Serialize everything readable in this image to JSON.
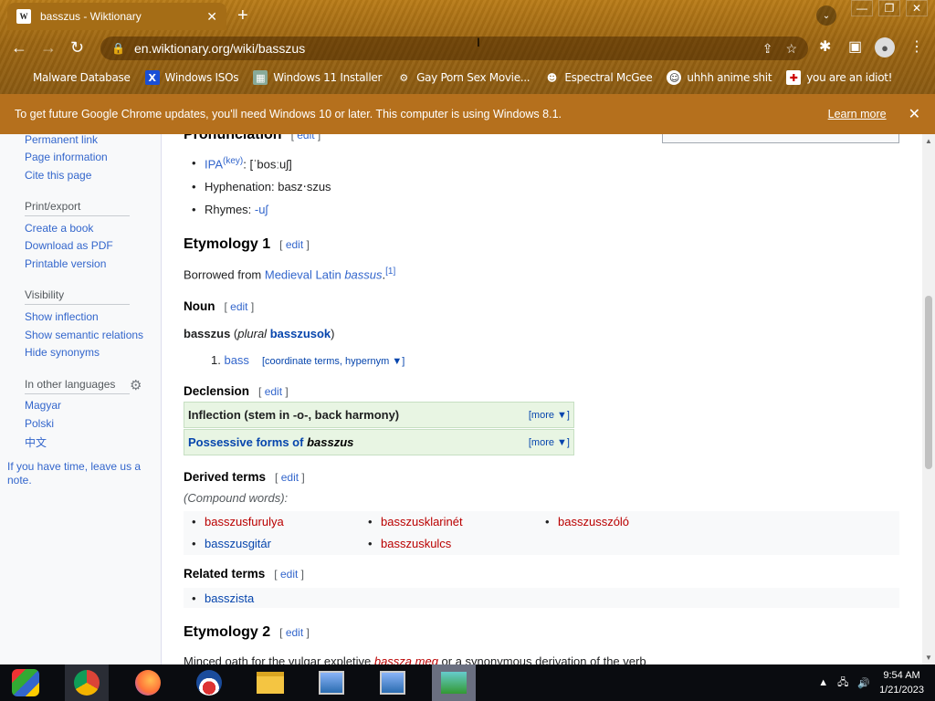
{
  "browser": {
    "tab_title": "basszus - Wiktionary",
    "tab_favicon": "W",
    "url": "en.wiktionary.org/wiki/basszus",
    "bookmarks": [
      {
        "label": "Malware Database",
        "icon": "skull-icon"
      },
      {
        "label": "Windows ISOs",
        "icon": "x-icon"
      },
      {
        "label": "Windows 11 Installer",
        "icon": "image-icon"
      },
      {
        "label": "Gay Porn Sex Movie...",
        "icon": "globe-icon"
      },
      {
        "label": "Espectral McGee",
        "icon": "face-icon"
      },
      {
        "label": "uhhh anime shit",
        "icon": "anime-icon"
      },
      {
        "label": "you are an idiot!",
        "icon": "flag-icon"
      }
    ],
    "infobar_message": "To get future Google Chrome updates, you'll need Windows 10 or later. This computer is using Windows 8.1.",
    "infobar_link": "Learn more"
  },
  "sidebar": {
    "links_top": [
      "Permanent link",
      "Page information",
      "Cite this page"
    ],
    "print_head": "Print/export",
    "print_links": [
      "Create a book",
      "Download as PDF",
      "Printable version"
    ],
    "visibility_head": "Visibility",
    "visibility_links": [
      "Show inflection",
      "Show semantic relations",
      "Hide synonyms"
    ],
    "languages_head": "In other languages",
    "languages": [
      "Magyar",
      "Polski",
      "中文"
    ],
    "note": "If you have time, leave us a note."
  },
  "content": {
    "pronunciation_head": "Pronunciation",
    "edit": "edit",
    "ipa_label": "IPA",
    "ipa_key": "(key)",
    "ipa_value": ": [ˈbosːuʃ]",
    "hyphenation": "Hyphenation: basz‧szus",
    "rhymes_label": "Rhymes: ",
    "rhymes_value": "-uʃ",
    "etym1_head": "Etymology 1",
    "borrowed_text": "Borrowed from ",
    "borrowed_link": "Medieval Latin",
    "borrowed_word": "bassus",
    "borrowed_ref": "[1]",
    "noun_head": "Noun",
    "headword": "basszus",
    "plural_label": "plural",
    "plural_value": "basszusok",
    "def_number": "1.",
    "def_word": "bass",
    "def_extra": "[coordinate terms, hypernym ▼]",
    "declension_head": "Declension",
    "inflection_box": "Inflection (stem in -o-, back harmony)",
    "possessive_box_prefix": "Possessive forms of ",
    "possessive_box_word": "basszus",
    "more": "[more ▼]",
    "derived_head": "Derived terms",
    "compound_label": "(Compound words):",
    "derived_terms": [
      {
        "label": "basszusfurulya",
        "color": "#ba0000"
      },
      {
        "label": "basszusklarinét",
        "color": "#ba0000"
      },
      {
        "label": "basszusszóló",
        "color": "#ba0000"
      },
      {
        "label": "basszusgitár",
        "color": "#0645ad"
      },
      {
        "label": "basszuskulcs",
        "color": "#ba0000"
      }
    ],
    "related_head": "Related terms",
    "related_terms": [
      "basszista"
    ],
    "etym2_head": "Etymology 2",
    "etym2_text_prefix": "Minced oath for the vulgar expletive ",
    "etym2_link": "bassza meg",
    "etym2_text_suffix": " or a synonymous derivation of the verb"
  },
  "taskbar": {
    "time": "9:54 AM",
    "date": "1/21/2023",
    "apps": [
      "windows-app-icon",
      "chrome-icon",
      "firefox-icon",
      "obama-icon",
      "file-explorer-icon",
      "network-app-icon",
      "network-app-2-icon",
      "desktop-app-icon"
    ]
  }
}
